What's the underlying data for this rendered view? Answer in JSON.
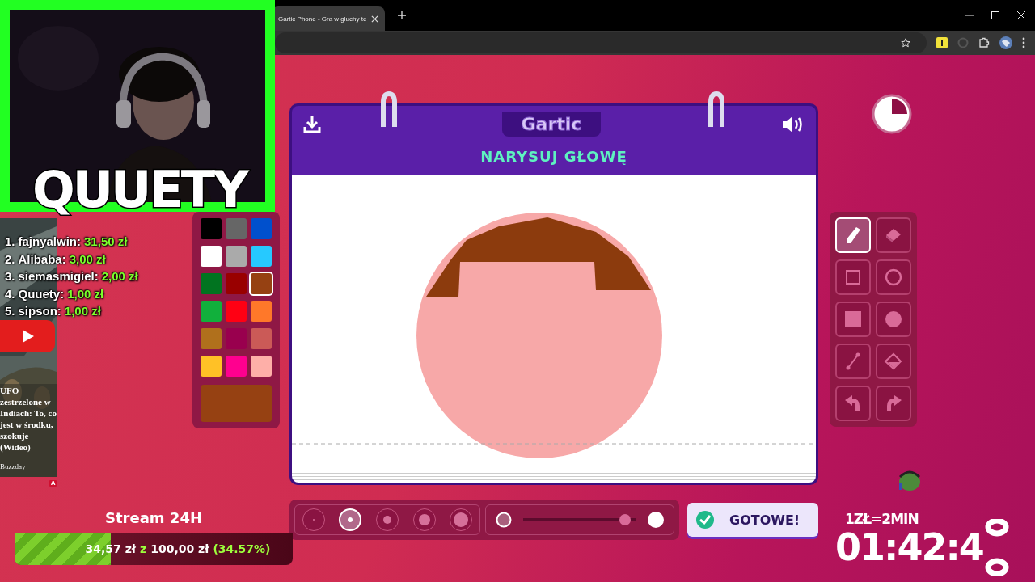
{
  "browser": {
    "tab": {
      "title": "Gartic Phone - Gra w głuchy te",
      "selected": true
    }
  },
  "overlay_name": "QUUETY",
  "leaderboard": [
    {
      "rank": "1.",
      "name": "fajnyalwin:",
      "amount": "31,50 zł"
    },
    {
      "rank": "2.",
      "name": "Alibaba:",
      "amount": "3,00 zł"
    },
    {
      "rank": "3.",
      "name": "siemasmigiel:",
      "amount": "2,00 zł"
    },
    {
      "rank": "4.",
      "name": "Quuety:",
      "amount": "1,00 zł"
    },
    {
      "rank": "5.",
      "name": "sipson:",
      "amount": "1,00 zł"
    }
  ],
  "ad": {
    "headline": "UFO zestrzelone w Indiach: To, co jest w środku, szokuje (Wideo)",
    "source": "Buzzday",
    "badge": "A"
  },
  "game": {
    "logo": "Gartic",
    "prompt": "NARYSUJ GŁOWĘ",
    "palette": [
      {
        "color": "#000000",
        "selected": false
      },
      {
        "color": "#666666",
        "selected": false
      },
      {
        "color": "#0050cd",
        "selected": false
      },
      {
        "color": "#ffffff",
        "selected": false
      },
      {
        "color": "#aaaaaa",
        "selected": false
      },
      {
        "color": "#26c9ff",
        "selected": false
      },
      {
        "color": "#017420",
        "selected": false
      },
      {
        "color": "#990000",
        "selected": false
      },
      {
        "color": "#964112",
        "selected": true
      },
      {
        "color": "#11b03c",
        "selected": false
      },
      {
        "color": "#ff0013",
        "selected": false
      },
      {
        "color": "#ff7829",
        "selected": false
      },
      {
        "color": "#b0701c",
        "selected": false
      },
      {
        "color": "#99004e",
        "selected": false
      },
      {
        "color": "#cb5a57",
        "selected": false
      },
      {
        "color": "#ffc126",
        "selected": false
      },
      {
        "color": "#ff008f",
        "selected": false
      },
      {
        "color": "#feafa8",
        "selected": false
      }
    ],
    "current_color": {
      "color": "#964112"
    },
    "tools": [
      {
        "kind": "pencil",
        "selected": true
      },
      {
        "kind": "eraser",
        "selected": false
      },
      {
        "kind": "rectangle",
        "selected": false
      },
      {
        "kind": "ellipse",
        "selected": false
      },
      {
        "kind": "filled-rectangle",
        "selected": false
      },
      {
        "kind": "filled-ellipse",
        "selected": false
      },
      {
        "kind": "line",
        "selected": false
      },
      {
        "kind": "bucket",
        "selected": false
      },
      {
        "kind": "undo",
        "selected": false
      },
      {
        "kind": "redo",
        "selected": false
      }
    ],
    "brush_sizes": [
      {
        "selected": false
      },
      {
        "selected": true
      },
      {
        "selected": false
      },
      {
        "selected": false
      },
      {
        "selected": false
      }
    ],
    "opacity": {
      "level": 0.9
    },
    "done_button": "GOTOWE!"
  },
  "goal": {
    "title": "Stream 24H",
    "level": 0.3457,
    "raised": "34,57 zł",
    "separator": "z",
    "target": "100,00 zł",
    "percent": "(34.57%)"
  },
  "timer": {
    "rate": "1ZŁ=2MIN",
    "time": "01:42:4"
  }
}
